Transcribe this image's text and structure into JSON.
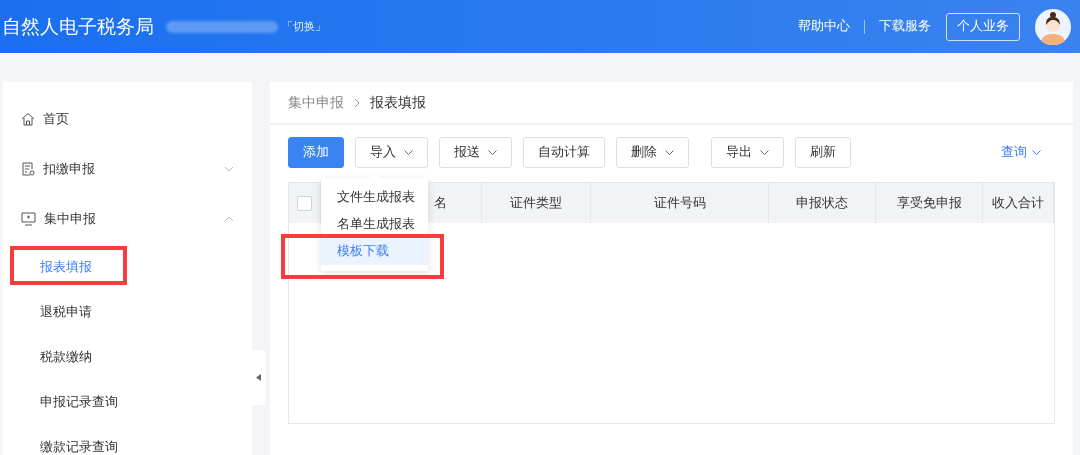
{
  "header": {
    "title": "自然人电子税务局",
    "switch_link": "「切换」",
    "links": [
      "帮助中心",
      "下载服务"
    ],
    "account_button": "个人业务"
  },
  "sidebar": {
    "items": [
      {
        "kind": "link",
        "label": "首页"
      },
      {
        "kind": "group",
        "label": "扣缴申报",
        "expanded": false
      },
      {
        "kind": "group",
        "label": "集中申报",
        "expanded": true,
        "children": [
          {
            "label": "报表填报",
            "selected": true,
            "highlighted": true
          },
          {
            "label": "退税申请",
            "selected": false,
            "highlighted": false
          },
          {
            "label": "税款缴纳",
            "selected": false,
            "highlighted": false
          },
          {
            "label": "申报记录查询",
            "selected": false,
            "highlighted": false
          },
          {
            "label": "缴款记录查询",
            "selected": false,
            "highlighted": false
          }
        ]
      }
    ]
  },
  "breadcrumb": [
    "集中申报",
    "报表填报"
  ],
  "toolbar": {
    "buttons": [
      {
        "label": "添加",
        "kind": "primary",
        "caret": false
      },
      {
        "label": "导入",
        "kind": "plain",
        "caret": true
      },
      {
        "label": "报送",
        "kind": "plain",
        "caret": true
      },
      {
        "label": "自动计算",
        "kind": "plain",
        "caret": false
      },
      {
        "label": "删除",
        "kind": "plain",
        "caret": true
      },
      {
        "label": "导出",
        "kind": "plain",
        "caret": true
      },
      {
        "label": "刷新",
        "kind": "plain",
        "caret": false
      }
    ],
    "query_link": "查询"
  },
  "dropdown": {
    "items": [
      {
        "label": "文件生成报表",
        "selected": false,
        "highlighted": false
      },
      {
        "label": "名单生成报表",
        "selected": false,
        "highlighted": false
      },
      {
        "label": "模板下载",
        "selected": true,
        "highlighted": true
      }
    ]
  },
  "table": {
    "select_all_checked": false,
    "columns": [
      "名",
      "证件类型",
      "证件号码",
      "申报状态",
      "享受免申报",
      "收入合计"
    ]
  }
}
